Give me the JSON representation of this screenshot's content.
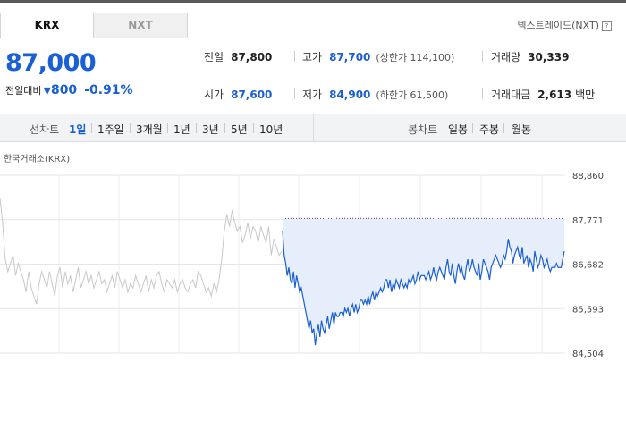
{
  "tabs": {
    "krx": "KRX",
    "nxt": "NXT"
  },
  "nextrade_link": "넥스트레이드(NXT)",
  "help_icon": "?",
  "price": "87,000",
  "change": {
    "label": "전일대비",
    "direction": "down",
    "amount": "800",
    "percent": "-0.91%"
  },
  "stats": {
    "prev_close_label": "전일",
    "prev_close": "87,800",
    "high_label": "고가",
    "high": "87,700",
    "upper_limit": "(상한가 114,100)",
    "volume_label": "거래량",
    "volume": "30,339",
    "open_label": "시가",
    "open": "87,600",
    "low_label": "저가",
    "low": "84,900",
    "lower_limit": "(하한가 61,500)",
    "amount_label": "거래대금",
    "amount": "2,613",
    "amount_unit": "백만"
  },
  "toolbar": {
    "line_chart_label": "선차트",
    "periods": [
      "1일",
      "1주일",
      "3개월",
      "1년",
      "3년",
      "5년",
      "10년"
    ],
    "selected_period": "1일",
    "candle_chart_label": "봉차트",
    "candles": [
      "일봉",
      "주봉",
      "월봉"
    ]
  },
  "exchange_label": "한국거래소(KRX)",
  "colors": {
    "accent": "#1a5fd3",
    "fill": "#e6eefb",
    "prev_line": "#c8c8c8"
  },
  "chart_data": {
    "type": "line",
    "title": "",
    "ylim": [
      84504,
      88860
    ],
    "y_ticks": [
      "88,860",
      "87,771",
      "86,682",
      "85,593",
      "84,504"
    ],
    "reference_line": 87800,
    "series": [
      {
        "values": [
          88300,
          87700,
          86800,
          86500,
          86700,
          86900,
          86400,
          86700,
          86500,
          86300,
          86000,
          86500,
          86100,
          85900,
          85700,
          86200,
          86500,
          86300,
          86100,
          86500,
          86200,
          85900,
          86400,
          86600,
          86100,
          86500,
          86200,
          86400,
          86000,
          86300,
          86600,
          86100,
          86300,
          86500,
          86200,
          86400,
          86100,
          86300,
          86500,
          86200,
          86300,
          86000,
          86200,
          86400,
          86100,
          86500,
          86300,
          86100,
          86300,
          86000,
          86200,
          86100,
          86400,
          86200,
          86000,
          86200,
          86400,
          86000,
          86300,
          86100,
          86400,
          86500,
          86200,
          86000,
          86300,
          86200,
          86100,
          86300,
          86000,
          86200,
          86300,
          86100,
          86000,
          86200,
          86300,
          86100,
          86500,
          86400,
          86200,
          86000,
          86100,
          85900,
          86200,
          86000,
          86300,
          86800,
          87500,
          87900,
          87600,
          88000,
          87700,
          87500,
          87600,
          87200,
          87400,
          87700,
          87300,
          87600,
          87500,
          87200,
          87600,
          87400,
          87200,
          87600,
          86900,
          87300,
          87100,
          86900,
          87000
        ]
      },
      {
        "values": [
          87500,
          86900,
          86700,
          86400,
          86600,
          86300,
          86200,
          86500,
          86100,
          86400,
          86200,
          86000,
          86100,
          85900,
          85700,
          85500,
          85300,
          85100,
          85300,
          85000,
          85100,
          84700,
          85000,
          85200,
          84900,
          85300,
          85100,
          85000,
          85200,
          85400,
          85100,
          85300,
          85500,
          85200,
          85500,
          85400,
          85400,
          85500,
          85500,
          85400,
          85600,
          85500,
          85600,
          85400,
          85600,
          85700,
          85500,
          85700,
          85500,
          85600,
          85800,
          85800,
          85700,
          85800,
          85700,
          85900,
          85700,
          85900,
          86000,
          85800,
          86000,
          85900,
          86000,
          86100,
          86000,
          86100,
          86300,
          86300,
          86100,
          86300,
          86000,
          86200,
          86100,
          86300,
          86200,
          86100,
          86300,
          86200,
          86100,
          86200,
          86100,
          86300,
          86200,
          86300,
          86400,
          86200,
          86300,
          86500,
          86300,
          86400,
          86400,
          86400,
          86300,
          86400,
          86500,
          86300,
          86400,
          86600,
          86400,
          86300,
          86500,
          86600,
          86500,
          86400,
          86300,
          86600,
          86800,
          86500,
          86400,
          86700,
          86400,
          86200,
          86500,
          86700,
          86500,
          86600,
          86400,
          86300,
          86600,
          86800,
          86500,
          86600,
          86800,
          86600,
          86500,
          86400,
          86700,
          86300,
          86500,
          86800,
          86700,
          86600,
          86500,
          86300,
          86600,
          86700,
          86800,
          86900,
          86800,
          86700,
          86600,
          86700,
          86900,
          86800,
          87000,
          87300,
          87100,
          87000,
          86700,
          86900,
          87000,
          87100,
          86900,
          86800,
          87100,
          86700,
          86800,
          86900,
          86600,
          86800,
          86700,
          86500,
          87000,
          86800,
          86600,
          86700,
          86900,
          86800,
          86600,
          86700,
          86800,
          86600,
          86500,
          86600,
          86600,
          86600,
          86700,
          86600,
          86600,
          86600,
          86800,
          87000
        ]
      }
    ]
  }
}
